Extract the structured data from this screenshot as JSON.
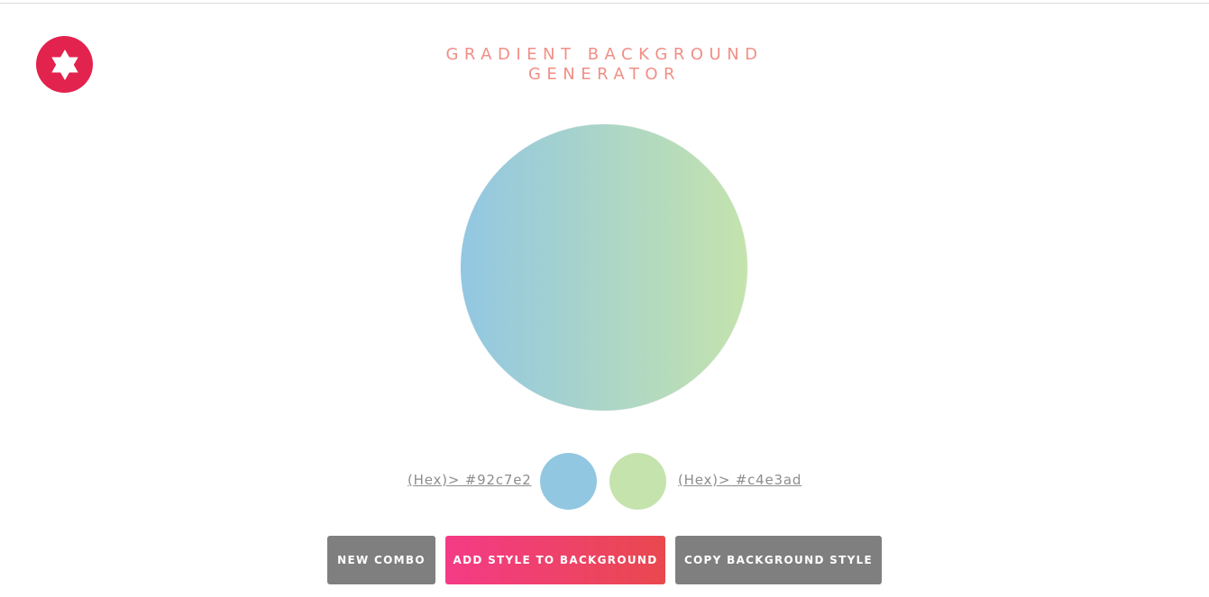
{
  "header": {
    "title_line1": "GRADIENT BACKGROUND",
    "title_line2": "GENERATOR",
    "logo_icon": "star-of-david-icon",
    "logo_color": "#e2234e",
    "title_color": "#f08f86"
  },
  "gradient": {
    "color1": "#92c7e2",
    "color2": "#c4e3ad",
    "direction": "to right"
  },
  "colors": {
    "left_label": "(Hex)> #92c7e2",
    "right_label": "(Hex)> #c4e3ad"
  },
  "buttons": {
    "new_combo": "NEW COMBO",
    "add_style": "ADD STYLE TO BACKGROUND",
    "copy_style": "COPY BACKGROUND STYLE",
    "gray_color": "#7f7f7f",
    "accent_gradient_start": "#f43b86",
    "accent_gradient_end": "#e9484f"
  }
}
